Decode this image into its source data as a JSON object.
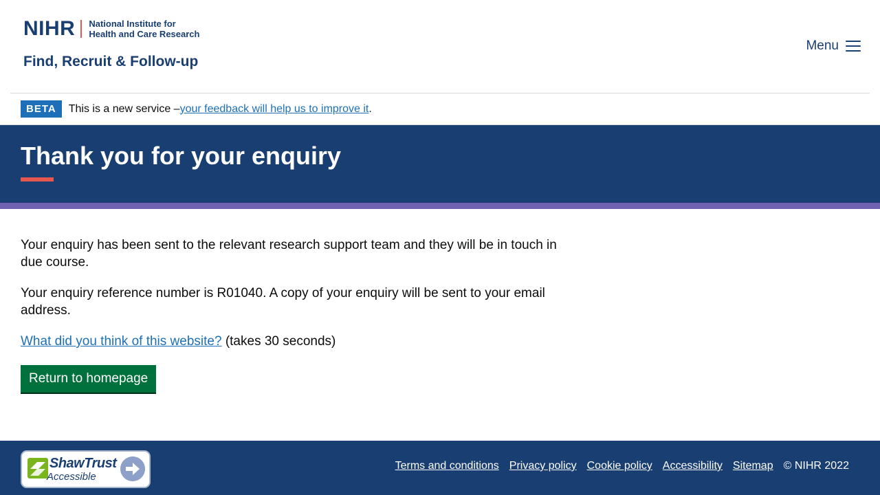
{
  "header": {
    "logo_mark": "NIHR",
    "logo_sub_line1": "National Institute for",
    "logo_sub_line2": "Health and Care Research",
    "service_name": "Find, Recruit & Follow-up",
    "menu_label": "Menu",
    "menu_icon": "hamburger-icon"
  },
  "beta": {
    "tag": "BETA",
    "text": "This is a new service – ",
    "link": "your feedback will help us to improve it",
    "suffix": "."
  },
  "hero": {
    "title": "Thank you for your enquiry"
  },
  "main": {
    "para1": "Your enquiry has been sent to the relevant research support team and they will be in touch in due course.",
    "para2": "Your enquiry reference number is R01040. A copy of your enquiry will be sent to your email address.",
    "survey_link": "What did you think of this website?",
    "survey_suffix": " (takes 30 seconds)",
    "home_button": "Return to homepage"
  },
  "footer": {
    "badge_brand": "ShawTrust",
    "badge_sub": "Accessible",
    "links": [
      "Terms and conditions",
      "Privacy policy",
      "Cookie policy",
      "Accessibility",
      "Sitemap"
    ],
    "copyright": "© NIHR 2022"
  },
  "colors": {
    "navy": "#193e72",
    "accent_red": "#e5574f",
    "purple": "#6f62b0",
    "link_blue": "#1d70b8",
    "button_green": "#00703c"
  }
}
